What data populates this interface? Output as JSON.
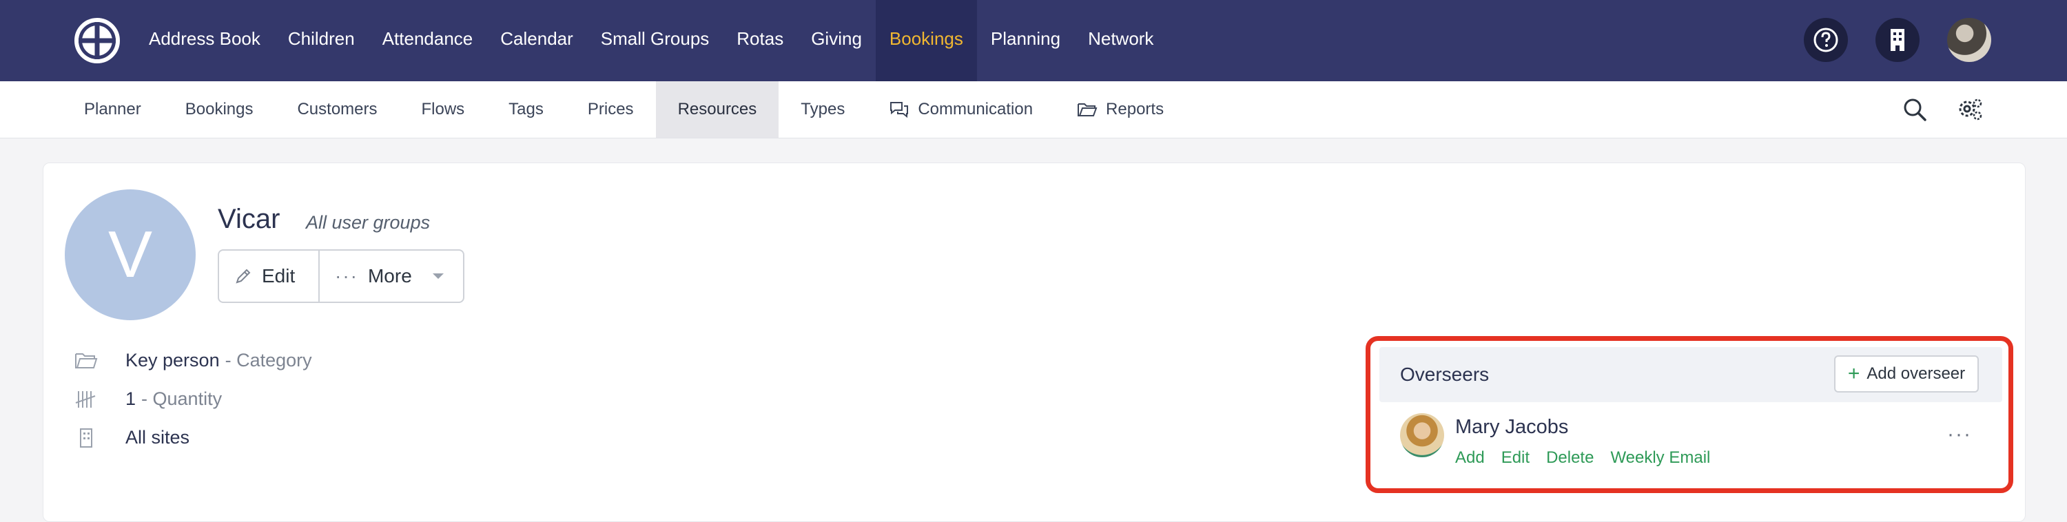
{
  "topnav": {
    "items": [
      "Address Book",
      "Children",
      "Attendance",
      "Calendar",
      "Small Groups",
      "Rotas",
      "Giving",
      "Bookings",
      "Planning",
      "Network"
    ],
    "active_index": 7,
    "accent": "#f0b731",
    "background": "#34386b"
  },
  "subnav": {
    "items": [
      "Planner",
      "Bookings",
      "Customers",
      "Flows",
      "Tags",
      "Prices",
      "Resources",
      "Types",
      "Communication",
      "Reports"
    ],
    "active_index": 6
  },
  "resource": {
    "avatar_letter": "V",
    "name": "Vicar",
    "groups": "All user groups",
    "edit_label": "Edit",
    "more_label": "More",
    "category_value": "Key person",
    "category_label": "- Category",
    "quantity_value": "1",
    "quantity_label": "- Quantity",
    "sites": "All sites"
  },
  "overseers": {
    "title": "Overseers",
    "add_label": "Add overseer",
    "people": [
      {
        "name": "Mary Jacobs",
        "actions": [
          "Add",
          "Edit",
          "Delete",
          "Weekly Email"
        ]
      }
    ],
    "highlight_color": "#e53222"
  }
}
